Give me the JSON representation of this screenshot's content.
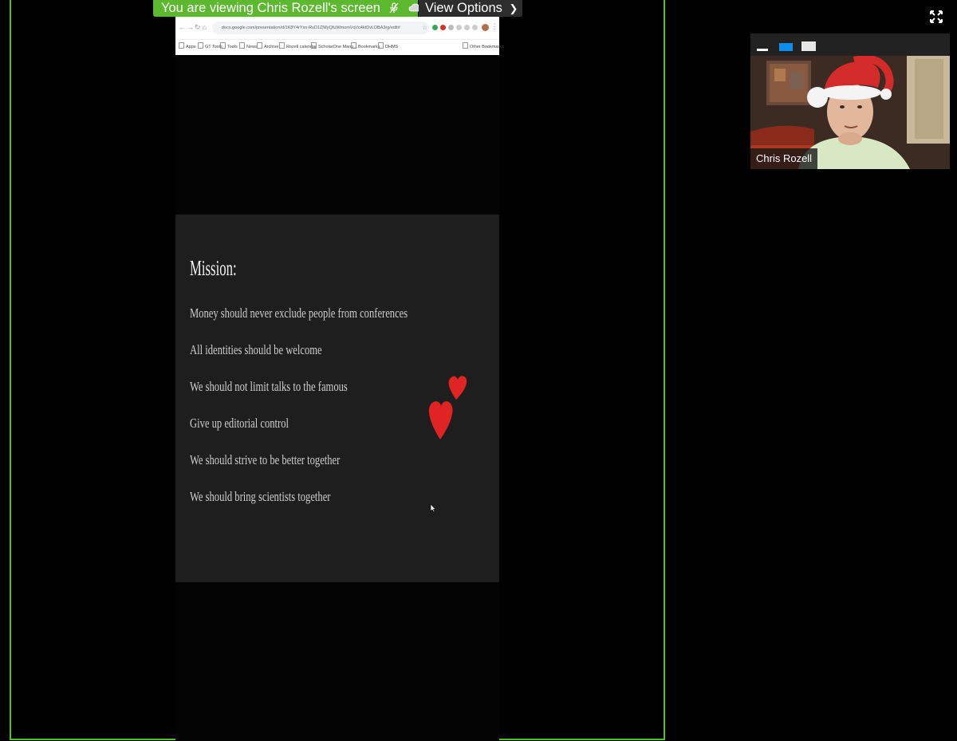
{
  "banner": {
    "sharing_text": "You are viewing Chris Rozell's screen",
    "view_options_label": "View Options"
  },
  "browser": {
    "url": "docs.google.com/presentation/d/1K8Y4rYxn-RsD1ZNfyQfuWmomVqVc4ktDvLDBA3rg/edit#",
    "bookmarks": [
      "Apps",
      "GT Tools",
      "Tools",
      "News",
      "Archive",
      "Rozell calendar",
      "ScholarOne Manu...",
      "Bookmarks",
      "DHMS"
    ],
    "other_bookmarks": "Other Bookmarks"
  },
  "slide": {
    "title": "Mission:",
    "lines": [
      "Money should never exclude people from conferences",
      "All identities should be welcome",
      "We should not limit talks to the famous",
      "Give up editorial control",
      "We should strive to be better together",
      "We should bring scientists together"
    ]
  },
  "video": {
    "participant_name": "Chris Rozell"
  },
  "colors": {
    "share_border": "#4fc22a",
    "banner_green": "#5cb82e",
    "slide_background": "#1e1e1e",
    "heart_red": "#e02020",
    "active_layout_blue": "#0e8ee9"
  },
  "icons": [
    "microphone-muted-icon",
    "cloud-icon",
    "chevron-down-icon",
    "fullscreen-icon",
    "heart-icon",
    "cursor-icon"
  ]
}
